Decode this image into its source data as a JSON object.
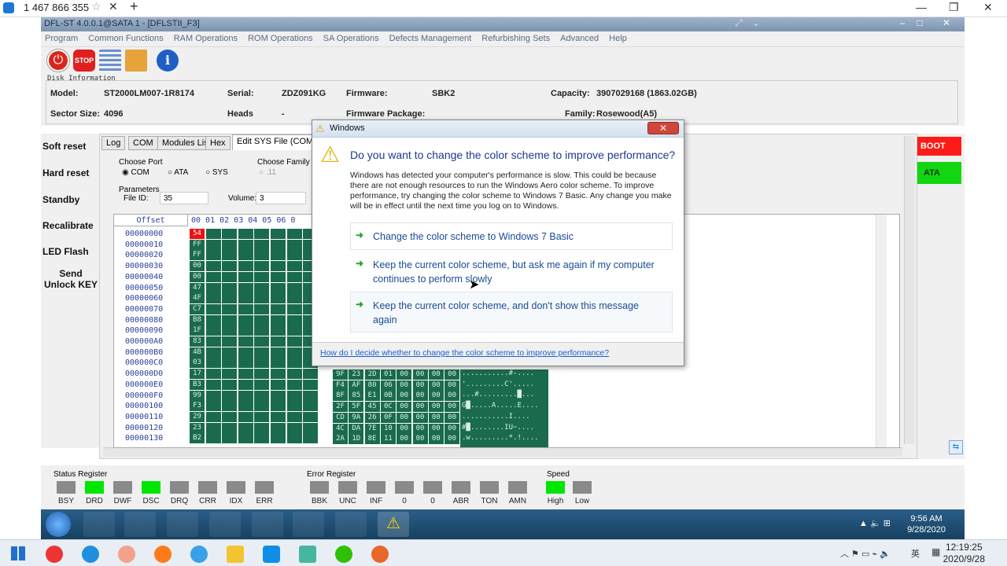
{
  "outer": {
    "tab_title": "1 467 866 355",
    "star": "☆",
    "close": "✕",
    "plus": "+"
  },
  "app": {
    "title": "DFL-ST 4.0.0.1@SATA 1 - [DFLSTII_F3]"
  },
  "menu": [
    "Program",
    "Common Functions",
    "RAM Operations",
    "ROM Operations",
    "SA Operations",
    "Defects Management",
    "Refurbishing Sets",
    "Advanced",
    "Help"
  ],
  "toolbar": {
    "stop": "STOP"
  },
  "disk": {
    "legend": "Disk Information",
    "model_label": "Model:",
    "model": "ST2000LM007-1R8174",
    "serial_label": "Serial:",
    "serial": "ZDZ091KG",
    "firmware_label": "Firmware:",
    "firmware": "SBK2",
    "capacity_label": "Capacity:",
    "capacity": "3907029168 (1863.02GB)",
    "sector_label": "Sector Size:",
    "sector": "4096",
    "heads_label": "Heads",
    "heads": "-",
    "fwpkg_label": "Firmware Package:",
    "family_label": "Family:",
    "family": "Rosewood(A5)"
  },
  "left": [
    "Soft reset",
    "Hard reset",
    "Standby",
    "Recalibrate",
    "LED Flash",
    "Send Unlock KEY"
  ],
  "tabs": [
    "Log",
    "COM",
    "Modules List",
    "Hex",
    "Edit SYS File (COM Or"
  ],
  "port": {
    "title": "Choose Port",
    "opts": [
      "COM",
      "ATA",
      "SYS"
    ]
  },
  "family": {
    "title": "Choose Family",
    "opt": ".11"
  },
  "params": {
    "title": "Parameters",
    "file_label": "File ID:",
    "file_id": "35",
    "vol_label": "Volume:",
    "volume": "3"
  },
  "hex": {
    "offset_header": "Offset",
    "col_header": "00 01 02 03 04 05 06 0",
    "offsets": [
      "00000000",
      "00000010",
      "00000020",
      "00000030",
      "00000040",
      "00000050",
      "00000060",
      "00000070",
      "00000080",
      "00000090",
      "000000A0",
      "000000B0",
      "000000C0",
      "000000D0",
      "000000E0",
      "000000F0",
      "00000100",
      "00000110",
      "00000120",
      "00000130"
    ],
    "first_col": [
      "54",
      "FF",
      "FF",
      "00",
      "00",
      "47",
      "4F",
      "C7",
      "B8",
      "1F",
      "83",
      "4B",
      "03",
      "17",
      "B3",
      "99",
      "F3",
      "29",
      "23",
      "B2"
    ],
    "right_cols": [
      [
        "9F",
        "23",
        "2D",
        "01",
        "00",
        "00",
        "00",
        "00"
      ],
      [
        "F4",
        "AF",
        "80",
        "06",
        "00",
        "00",
        "00",
        "00"
      ],
      [
        "8F",
        "85",
        "E1",
        "0B",
        "00",
        "00",
        "00",
        "00"
      ],
      [
        "2F",
        "5F",
        "45",
        "0C",
        "00",
        "00",
        "00",
        "00"
      ],
      [
        "CD",
        "9A",
        "26",
        "0F",
        "00",
        "00",
        "00",
        "00"
      ],
      [
        "4C",
        "DA",
        "7E",
        "10",
        "00",
        "00",
        "00",
        "00"
      ],
      [
        "2A",
        "1D",
        "8E",
        "11",
        "00",
        "00",
        "00",
        "00"
      ]
    ],
    "ascii_rows": [
      "...........#-....",
      "'.........C'.....",
      "...#.........█...",
      "G█.....A.....E....",
      "...........I....",
      "#█........IU~....",
      ".w.........*.!...."
    ]
  },
  "right": {
    "boot": "BOOT",
    "ata": "ATA"
  },
  "status_register": {
    "title": "Status Register",
    "labels": [
      "BSY",
      "DRD",
      "DWF",
      "DSC",
      "DRQ",
      "CRR",
      "IDX",
      "ERR"
    ],
    "on": [
      false,
      true,
      false,
      true,
      false,
      false,
      false,
      false
    ]
  },
  "error_register": {
    "title": "Error Register",
    "labels": [
      "BBK",
      "UNC",
      "INF",
      "0",
      "0",
      "ABR",
      "TON",
      "AMN"
    ]
  },
  "speed": {
    "title": "Speed",
    "labels": [
      "High",
      "Low"
    ],
    "on": [
      true,
      false
    ]
  },
  "inner_clock": {
    "time": "9:56 AM",
    "date": "9/28/2020"
  },
  "host_clock": {
    "time": "12:19:25",
    "date": "2020/9/28"
  },
  "host_tray": {
    "ime": "英"
  },
  "dialog": {
    "title": "Windows",
    "question": "Do you want to change the color scheme to improve performance?",
    "description": "Windows has detected your computer's performance is slow. This could be because there are not enough resources to run the Windows Aero color scheme. To improve performance, try changing the color scheme to Windows 7 Basic. Any change you make will be in effect until the next time you log on to Windows.",
    "options": [
      "Change the color scheme to Windows 7 Basic",
      "Keep the current color scheme, but ask me again if my computer continues to perform slowly",
      "Keep the current color scheme, and don't show this message again"
    ],
    "help_link": "How do I decide whether to change the color scheme to improve performance?"
  },
  "colors": {
    "accent": "#1b4a96",
    "led_on": "#00e600",
    "hex_bg": "#1a6b4e",
    "boot": "#ff1a1a"
  }
}
